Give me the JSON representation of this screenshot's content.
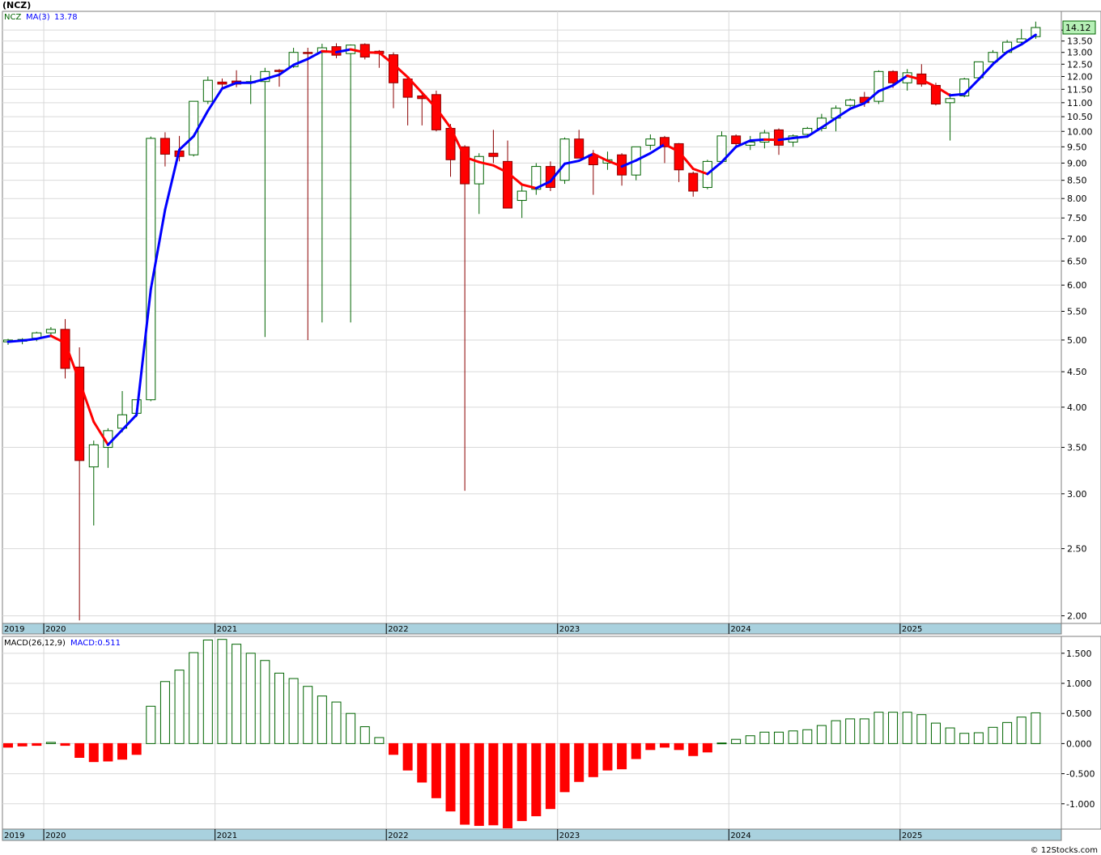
{
  "page_title": "(NCZ)",
  "credit": "© 12Stocks.com",
  "colors": {
    "up_fill": "#ffffff",
    "up_stroke": "#006400",
    "down_fill": "#ff0000",
    "down_stroke": "#8b0000",
    "ma_up": "#0000ff",
    "ma_down": "#ff0000",
    "macd_pos": "#ffffff",
    "macd_pos_stroke": "#006400",
    "macd_neg": "#ff0000",
    "axis_band": "#a9d1de",
    "grid": "#d9d9d9",
    "last_price_box": "#b6f0b6"
  },
  "chart_data": [
    {
      "type": "candlestick",
      "legend": {
        "symbol": "NCZ",
        "ma_label": "MA(3)",
        "ma_value": "13.78"
      },
      "last_price_label": "14.12",
      "scale": "log",
      "ylim": [
        1.95,
        14.9
      ],
      "yticks": [
        "2.00",
        "2.50",
        "3.00",
        "3.50",
        "4.00",
        "4.50",
        "5.00",
        "5.50",
        "6.00",
        "6.50",
        "7.00",
        "7.50",
        "8.00",
        "8.50",
        "9.00",
        "9.50",
        "10.00",
        "10.50",
        "11.00",
        "11.50",
        "12.00",
        "12.50",
        "13.00",
        "13.50",
        "14.00"
      ],
      "x_labels": [
        {
          "label": "2019",
          "index": -0.5
        },
        {
          "label": "2020",
          "index": 3
        },
        {
          "label": "2021",
          "index": 15
        },
        {
          "label": "2022",
          "index": 27
        },
        {
          "label": "2023",
          "index": 39
        },
        {
          "label": "2024",
          "index": 51
        },
        {
          "label": "2025",
          "index": 63
        }
      ],
      "candles": [
        {
          "o": 4.97,
          "h": 5.02,
          "l": 4.92,
          "c": 5.0
        },
        {
          "o": 4.98,
          "h": 5.03,
          "l": 4.93,
          "c": 5.01
        },
        {
          "o": 5.03,
          "h": 5.14,
          "l": 4.98,
          "c": 5.12
        },
        {
          "o": 5.12,
          "h": 5.22,
          "l": 5.08,
          "c": 5.18
        },
        {
          "o": 5.18,
          "h": 5.36,
          "l": 4.4,
          "c": 4.55
        },
        {
          "o": 4.57,
          "h": 4.88,
          "l": 1.97,
          "c": 3.35
        },
        {
          "o": 3.28,
          "h": 3.58,
          "l": 2.7,
          "c": 3.53
        },
        {
          "o": 3.5,
          "h": 3.73,
          "l": 3.27,
          "c": 3.7
        },
        {
          "o": 3.73,
          "h": 4.22,
          "l": 3.68,
          "c": 3.9
        },
        {
          "o": 3.92,
          "h": 4.1,
          "l": 3.87,
          "c": 4.1
        },
        {
          "o": 4.1,
          "h": 9.83,
          "l": 4.08,
          "c": 9.77
        },
        {
          "o": 9.77,
          "h": 9.97,
          "l": 8.9,
          "c": 9.27
        },
        {
          "o": 9.37,
          "h": 9.85,
          "l": 9.05,
          "c": 9.2
        },
        {
          "o": 9.25,
          "h": 11.05,
          "l": 9.2,
          "c": 11.05
        },
        {
          "o": 11.05,
          "h": 12.0,
          "l": 10.95,
          "c": 11.85
        },
        {
          "o": 11.78,
          "h": 11.92,
          "l": 11.48,
          "c": 11.7
        },
        {
          "o": 11.82,
          "h": 12.25,
          "l": 11.58,
          "c": 11.7
        },
        {
          "o": 11.75,
          "h": 12.05,
          "l": 10.95,
          "c": 11.8
        },
        {
          "o": 11.8,
          "h": 12.35,
          "l": 5.05,
          "c": 12.2
        },
        {
          "o": 12.25,
          "h": 12.3,
          "l": 11.6,
          "c": 12.2
        },
        {
          "o": 12.4,
          "h": 13.2,
          "l": 12.35,
          "c": 13.0
        },
        {
          "o": 13.0,
          "h": 13.2,
          "l": 5.0,
          "c": 12.95
        },
        {
          "o": 13.0,
          "h": 13.38,
          "l": 5.3,
          "c": 13.2
        },
        {
          "o": 13.25,
          "h": 13.4,
          "l": 12.75,
          "c": 12.88
        },
        {
          "o": 12.95,
          "h": 13.35,
          "l": 5.3,
          "c": 13.32
        },
        {
          "o": 13.35,
          "h": 13.4,
          "l": 12.7,
          "c": 12.8
        },
        {
          "o": 13.05,
          "h": 13.1,
          "l": 12.35,
          "c": 12.95
        },
        {
          "o": 12.9,
          "h": 13.0,
          "l": 10.8,
          "c": 11.75
        },
        {
          "o": 11.9,
          "h": 12.0,
          "l": 10.2,
          "c": 11.2
        },
        {
          "o": 11.25,
          "h": 11.4,
          "l": 10.2,
          "c": 11.15
        },
        {
          "o": 11.3,
          "h": 11.45,
          "l": 10.0,
          "c": 10.05
        },
        {
          "o": 10.1,
          "h": 10.25,
          "l": 8.6,
          "c": 9.1
        },
        {
          "o": 9.5,
          "h": 9.55,
          "l": 3.03,
          "c": 8.4
        },
        {
          "o": 8.4,
          "h": 9.3,
          "l": 7.6,
          "c": 9.2
        },
        {
          "o": 9.3,
          "h": 10.05,
          "l": 9.0,
          "c": 9.2
        },
        {
          "o": 9.05,
          "h": 9.7,
          "l": 7.75,
          "c": 7.75
        },
        {
          "o": 7.95,
          "h": 8.35,
          "l": 7.5,
          "c": 8.2
        },
        {
          "o": 8.25,
          "h": 9.0,
          "l": 8.1,
          "c": 8.9
        },
        {
          "o": 8.9,
          "h": 9.05,
          "l": 8.2,
          "c": 8.3
        },
        {
          "o": 8.5,
          "h": 9.8,
          "l": 8.4,
          "c": 9.75
        },
        {
          "o": 9.75,
          "h": 10.05,
          "l": 9.15,
          "c": 9.15
        },
        {
          "o": 9.25,
          "h": 9.4,
          "l": 8.1,
          "c": 8.95
        },
        {
          "o": 9.0,
          "h": 9.35,
          "l": 8.8,
          "c": 9.1
        },
        {
          "o": 9.25,
          "h": 9.3,
          "l": 8.35,
          "c": 8.65
        },
        {
          "o": 8.65,
          "h": 9.5,
          "l": 8.5,
          "c": 9.5
        },
        {
          "o": 9.55,
          "h": 9.9,
          "l": 9.4,
          "c": 9.75
        },
        {
          "o": 9.8,
          "h": 9.85,
          "l": 9.0,
          "c": 9.5
        },
        {
          "o": 9.6,
          "h": 9.62,
          "l": 8.45,
          "c": 8.8
        },
        {
          "o": 8.7,
          "h": 8.75,
          "l": 8.05,
          "c": 8.2
        },
        {
          "o": 8.3,
          "h": 9.1,
          "l": 8.25,
          "c": 9.05
        },
        {
          "o": 9.05,
          "h": 10.0,
          "l": 9.0,
          "c": 9.85
        },
        {
          "o": 9.85,
          "h": 9.9,
          "l": 9.45,
          "c": 9.6
        },
        {
          "o": 9.55,
          "h": 9.85,
          "l": 9.4,
          "c": 9.65
        },
        {
          "o": 9.65,
          "h": 10.05,
          "l": 9.45,
          "c": 9.95
        },
        {
          "o": 10.05,
          "h": 10.1,
          "l": 9.25,
          "c": 9.55
        },
        {
          "o": 9.65,
          "h": 9.9,
          "l": 9.5,
          "c": 9.85
        },
        {
          "o": 9.9,
          "h": 10.15,
          "l": 9.85,
          "c": 10.1
        },
        {
          "o": 10.1,
          "h": 10.6,
          "l": 10.0,
          "c": 10.45
        },
        {
          "o": 10.45,
          "h": 10.9,
          "l": 10.0,
          "c": 10.8
        },
        {
          "o": 10.9,
          "h": 11.15,
          "l": 10.85,
          "c": 11.1
        },
        {
          "o": 11.2,
          "h": 11.4,
          "l": 10.85,
          "c": 11.0
        },
        {
          "o": 11.05,
          "h": 12.25,
          "l": 10.95,
          "c": 12.2
        },
        {
          "o": 12.2,
          "h": 12.25,
          "l": 11.55,
          "c": 11.75
        },
        {
          "o": 11.75,
          "h": 12.3,
          "l": 11.45,
          "c": 12.15
        },
        {
          "o": 12.1,
          "h": 12.5,
          "l": 11.6,
          "c": 11.7
        },
        {
          "o": 11.65,
          "h": 11.75,
          "l": 10.9,
          "c": 10.95
        },
        {
          "o": 11.0,
          "h": 11.35,
          "l": 9.7,
          "c": 11.15
        },
        {
          "o": 11.25,
          "h": 11.95,
          "l": 11.2,
          "c": 11.9
        },
        {
          "o": 11.95,
          "h": 12.6,
          "l": 11.9,
          "c": 12.6
        },
        {
          "o": 12.6,
          "h": 13.1,
          "l": 12.55,
          "c": 13.0
        },
        {
          "o": 13.0,
          "h": 13.55,
          "l": 12.95,
          "c": 13.45
        },
        {
          "o": 13.45,
          "h": 14.05,
          "l": 13.4,
          "c": 13.6
        },
        {
          "o": 13.7,
          "h": 14.4,
          "l": 13.6,
          "c": 14.12
        }
      ],
      "ma3": [
        4.97,
        4.99,
        5.02,
        5.07,
        4.95,
        4.36,
        3.81,
        3.53,
        3.71,
        3.9,
        5.92,
        7.71,
        9.41,
        9.84,
        10.71,
        11.53,
        11.75,
        11.75,
        11.9,
        12.07,
        12.47,
        12.72,
        13.05,
        13.01,
        13.13,
        13.0,
        12.99,
        12.5,
        11.97,
        11.37,
        10.8,
        10.12,
        9.18,
        9.03,
        8.93,
        8.72,
        8.38,
        8.28,
        8.47,
        8.98,
        9.07,
        9.28,
        9.07,
        8.9,
        9.08,
        9.3,
        9.58,
        9.35,
        8.83,
        8.68,
        9.03,
        9.5,
        9.7,
        9.73,
        9.72,
        9.78,
        9.83,
        10.13,
        10.45,
        10.78,
        10.98,
        11.43,
        11.65,
        12.03,
        11.87,
        11.6,
        11.27,
        11.32,
        11.88,
        12.5,
        13.02,
        13.35,
        13.78
      ]
    },
    {
      "type": "bar",
      "legend": {
        "label": "MACD(26,12,9)",
        "value_label": "MACD:0.511"
      },
      "ylim": [
        -1.42,
        1.78
      ],
      "yticks": [
        "1.500",
        "1.000",
        "0.500",
        "0.000",
        "-0.500",
        "-1.000"
      ],
      "x_labels": [
        {
          "label": "2019",
          "index": -0.5
        },
        {
          "label": "2020",
          "index": 3
        },
        {
          "label": "2021",
          "index": 15
        },
        {
          "label": "2022",
          "index": 27
        },
        {
          "label": "2023",
          "index": 39
        },
        {
          "label": "2024",
          "index": 51
        },
        {
          "label": "2025",
          "index": 63
        }
      ],
      "values": [
        -0.06,
        -0.04,
        -0.03,
        0.02,
        -0.03,
        -0.23,
        -0.3,
        -0.29,
        -0.26,
        -0.18,
        0.62,
        1.03,
        1.22,
        1.51,
        1.72,
        1.73,
        1.65,
        1.5,
        1.38,
        1.17,
        1.08,
        0.95,
        0.79,
        0.69,
        0.5,
        0.28,
        0.1,
        -0.18,
        -0.44,
        -0.64,
        -0.9,
        -1.12,
        -1.34,
        -1.36,
        -1.35,
        -1.4,
        -1.28,
        -1.2,
        -1.08,
        -0.8,
        -0.63,
        -0.55,
        -0.44,
        -0.42,
        -0.25,
        -0.1,
        -0.06,
        -0.1,
        -0.2,
        -0.14,
        0.01,
        0.07,
        0.13,
        0.19,
        0.19,
        0.21,
        0.23,
        0.3,
        0.38,
        0.41,
        0.41,
        0.52,
        0.52,
        0.52,
        0.48,
        0.34,
        0.26,
        0.17,
        0.18,
        0.27,
        0.35,
        0.44,
        0.51
      ]
    }
  ]
}
